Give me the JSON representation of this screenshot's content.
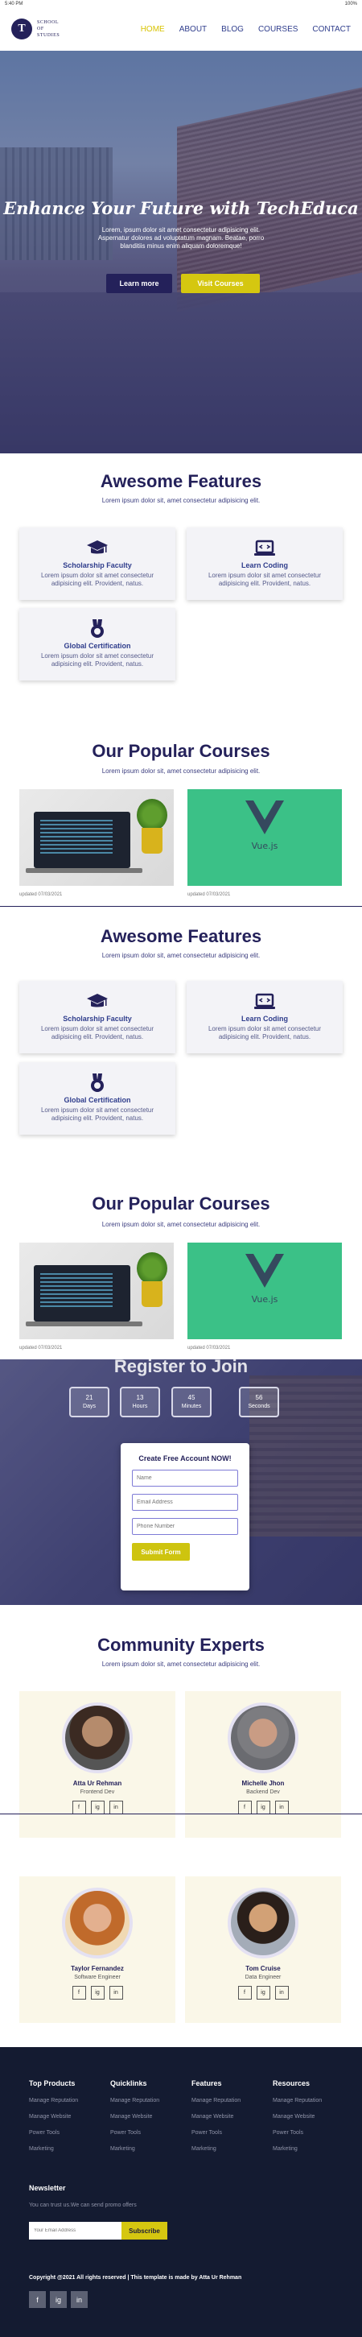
{
  "status_bar": {
    "time": "5:40 PM",
    "battery": "100%"
  },
  "header": {
    "logo_letter": "T",
    "logo_line1": "SCHOOL",
    "logo_line2": "OF",
    "logo_line3": "STUDIES",
    "nav": [
      "HOME",
      "ABOUT",
      "BLOG",
      "COURSES",
      "CONTACT"
    ]
  },
  "hero": {
    "title": "Enhance Your Future with TechEduca",
    "description": "Lorem, ipsum dolor sit amet consectetur adipisicing elit. Aspernatur dolores ad voluptatum magnam. Beatae, porro blanditiis minus enim aliquam doloremque!",
    "learn_more": "Learn more",
    "visit_courses": "Visit Courses"
  },
  "features": {
    "title": "Awesome Features",
    "subtitle": "Lorem ipsum dolor sit, amet consectetur adipisicing elit.",
    "items": [
      {
        "icon": "graduation-cap-icon",
        "title": "Scholarship Faculty",
        "desc": "Lorem ipsum dolor sit amet consectetur adipisicing elit. Provident, natus."
      },
      {
        "icon": "laptop-code-icon",
        "title": "Learn Coding",
        "desc": "Lorem ipsum dolor sit amet consectetur adipisicing elit. Provident, natus."
      },
      {
        "icon": "medal-icon",
        "title": "Global Certification",
        "desc": "Lorem ipsum dolor sit amet consectetur adipisicing elit. Provident, natus."
      }
    ]
  },
  "courses": {
    "title": "Our Popular Courses",
    "subtitle": "Lorem ipsum dolor sit, amet consectetur adipisicing elit.",
    "items": [
      {
        "image": "laptop-code-photo",
        "updated": "updated 07/03/2021"
      },
      {
        "image": "vuejs-logo",
        "vue_label": "Vue.js",
        "updated": "updated 07/03/2021"
      }
    ]
  },
  "register": {
    "title": "Register to Join",
    "countdown": [
      {
        "value": "21",
        "label": "Days"
      },
      {
        "value": "13",
        "label": "Hours"
      },
      {
        "value": "45",
        "label": "Minutes"
      },
      {
        "value": "56",
        "label": "Seconds"
      }
    ],
    "form_title": "Create Free Account NOW!",
    "name_placeholder": "Name",
    "email_placeholder": "Email Address",
    "phone_placeholder": "Phone Number",
    "submit": "Submit Form"
  },
  "experts": {
    "title": "Community Experts",
    "subtitle": "Lorem ipsum dolor sit, amet consectetur adipisicing elit.",
    "items": [
      {
        "name": "Atta Ur Rehman",
        "role": "Frontend Dev"
      },
      {
        "name": "Michelle Jhon",
        "role": "Backend Dev"
      },
      {
        "name": "Taylor Fernandez",
        "role": "Software Engineer"
      },
      {
        "name": "Tom Cruise",
        "role": "Data Engineer"
      }
    ],
    "social": [
      "f",
      "ig",
      "in"
    ]
  },
  "footer": {
    "columns": [
      {
        "heading": "Top Products",
        "links": [
          "Manage Reputation",
          "Manage Website",
          "Power Tools",
          "Marketing"
        ]
      },
      {
        "heading": "Quicklinks",
        "links": [
          "Manage Reputation",
          "Manage Website",
          "Power Tools",
          "Marketing"
        ]
      },
      {
        "heading": "Features",
        "links": [
          "Manage Reputation",
          "Manage Website",
          "Power Tools",
          "Marketing"
        ]
      },
      {
        "heading": "Resources",
        "links": [
          "Manage Reputation",
          "Manage Website",
          "Power Tools",
          "Marketing"
        ]
      }
    ],
    "newsletter_title": "Newsletter",
    "newsletter_desc": "You can trust us.We can send promo offers",
    "email_placeholder": "Your Email Address",
    "subscribe": "Subscribe",
    "copyright": "Copyright @2021 All rights reserved | This template is made by Atta Ur Rehman",
    "social": [
      "f",
      "ig",
      "in"
    ]
  }
}
